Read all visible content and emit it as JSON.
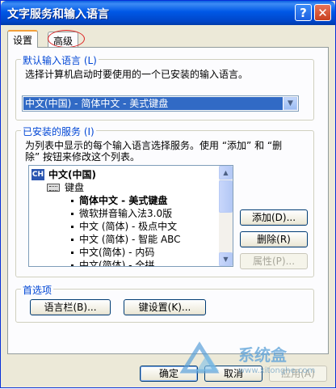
{
  "window": {
    "title": "文字服务和输入语言"
  },
  "titlebar": {
    "help_glyph": "?",
    "close_glyph": "✕"
  },
  "tabs": [
    {
      "label": "设置",
      "active": true
    },
    {
      "label": "高级",
      "active": false
    }
  ],
  "default_lang": {
    "legend": "默认输入语言 (L)",
    "description": "选择计算机启动时要使用的一个已安装的输入语言。",
    "selected": "中文(中国) - 简体中文 - 美式键盘"
  },
  "services": {
    "legend": "已安装的服务 (I)",
    "description_line1": "为列表中显示的每个输入语言选择服务。使用 “添加” 和 “删",
    "description_line2": "除” 按钮来修改这个列表。",
    "language_badge": "CH",
    "language": "中文(中国)",
    "category": "键盘",
    "items": [
      "简体中文 - 美式键盘",
      "微软拼音输入法3.0版",
      "中文 (简体) - 极点中文",
      "中文 (简体) - 智能 ABC",
      "中文(简体) - 内码",
      "中文(简体) - 全拼"
    ],
    "add_label": "添加(D)...",
    "remove_label": "删除(R)",
    "properties_label": "属性(P)..."
  },
  "preferences": {
    "legend": "首选项",
    "language_bar_label": "语言栏(B)...",
    "key_settings_label": "键设置(K)..."
  },
  "footer": {
    "ok_label": "确定",
    "cancel_label": "取消",
    "apply_label": "应用(A)"
  },
  "watermark": {
    "text": "系统盒",
    "url": "www.xitonghe.com"
  }
}
